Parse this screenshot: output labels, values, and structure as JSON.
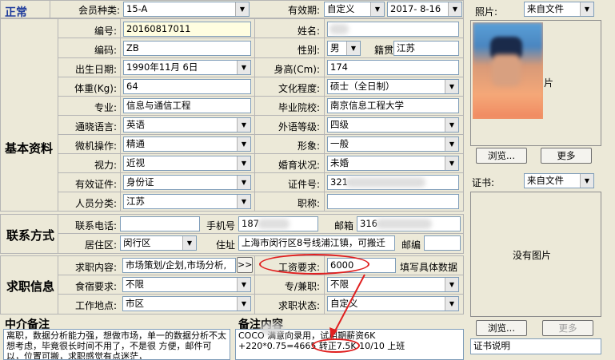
{
  "status": "正常",
  "header": {
    "member_type_label": "会员种类:",
    "member_type_value": "15-A",
    "validity_label": "有效期:",
    "validity_value": "自定义",
    "validity_date": "2017- 8-16",
    "photo_label": "照片:",
    "photo_source": "来自文件"
  },
  "basic": {
    "section_title": "基本资料",
    "fields": {
      "number_label": "编号:",
      "number_value": "20160817011",
      "name_label": "姓名:",
      "code_label": "编码:",
      "code_value": "ZB",
      "gender_label": "性别:",
      "gender_value": "男",
      "native_label": "籍贯",
      "native_value": "江苏",
      "birth_label": "出生日期:",
      "birth_value": "1990年11月 6日",
      "height_label": "身高(Cm):",
      "height_value": "174",
      "weight_label": "体重(Kg):",
      "weight_value": "64",
      "education_label": "文化程度:",
      "education_value": "硕士（全日制）",
      "major_label": "专业:",
      "major_value": "信息与通信工程",
      "school_label": "毕业院校:",
      "school_value": "南京信息工程大学",
      "language_label": "通晓语言:",
      "language_value": "英语",
      "foreign_level_label": "外语等级:",
      "foreign_level_value": "四级",
      "computer_label": "微机操作:",
      "computer_value": "精通",
      "image_label": "形象:",
      "image_value": "一般",
      "vision_label": "视力:",
      "vision_value": "近视",
      "marital_label": "婚育状况:",
      "marital_value": "未婚",
      "id_type_label": "有效证件:",
      "id_type_value": "身份证",
      "id_number_label": "证件号:",
      "id_number_value": "321",
      "category_label": "人员分类:",
      "category_value": "江苏",
      "title_label": "职称:"
    }
  },
  "photo": {
    "partial_text": "片",
    "browse_label": "浏览...",
    "more_label": "更多"
  },
  "certificate": {
    "label": "证书:",
    "source": "来自文件",
    "no_image": "没有图片",
    "browse_label": "浏览...",
    "more_label": "更多",
    "desc": "证书说明"
  },
  "contact": {
    "section_title": "联系方式",
    "phone_label": "联系电话:",
    "mobile_label": "手机号",
    "mobile_value": "187",
    "email_label": "邮箱",
    "email_value": "316",
    "area_label": "居住区:",
    "area_value": "闵行区",
    "address_label": "住址",
    "address_value": "上海市闵行区8号线浦江镇，可搬迁",
    "zip_label": "邮编"
  },
  "job": {
    "section_title": "求职信息",
    "content_label": "求职内容:",
    "content_value": "市场策划/企划,市场分析,",
    "more_btn": ">>",
    "salary_label": "工资要求:",
    "salary_value": "6000",
    "salary_hint": "填写具体数据",
    "meal_label": "食宿要求:",
    "meal_value": "不限",
    "parttime_label": "专/兼职:",
    "parttime_value": "不限",
    "location_label": "工作地点:",
    "location_value": "市区",
    "status_label": "求职状态:",
    "status_value": "自定义"
  },
  "notes": {
    "agency_title": "中介备注",
    "agency_text": "离职，数据分析能力强，想做市场，单一的数据分析不太想考虑，毕竟很长时间不用了，不是很 方便，邮件可以，位置可搬，求职感觉有点迷茫，",
    "remark_title": "备注内容",
    "remark_line1": "COCO    满意向录用，试用期薪资6K",
    "remark_line2": "+220*0.75=4665  转正7.5K 10/10 上班"
  },
  "colors": {
    "status_blue": "#1f3c9c",
    "annotation_red": "#e02020"
  }
}
